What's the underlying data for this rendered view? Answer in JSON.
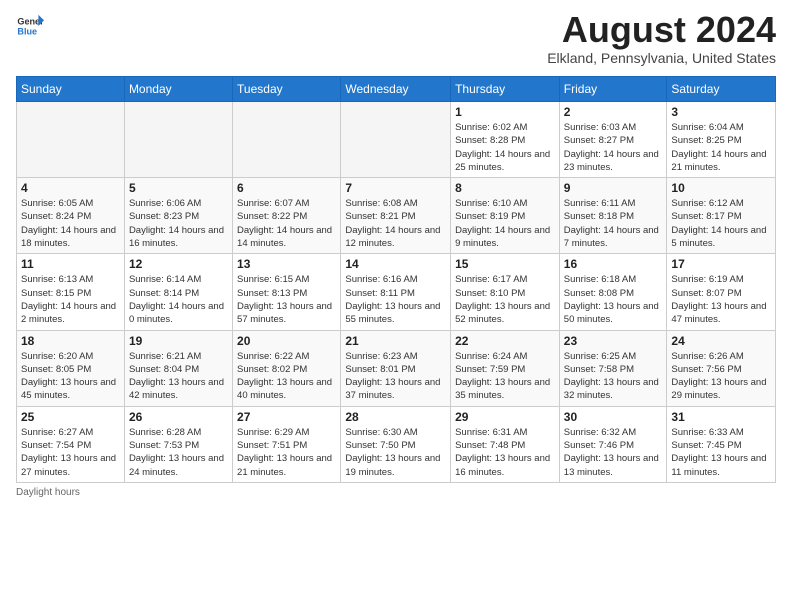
{
  "logo": {
    "line1": "General",
    "line2": "Blue"
  },
  "title": "August 2024",
  "subtitle": "Elkland, Pennsylvania, United States",
  "days_of_week": [
    "Sunday",
    "Monday",
    "Tuesday",
    "Wednesday",
    "Thursday",
    "Friday",
    "Saturday"
  ],
  "footer": "Daylight hours",
  "weeks": [
    [
      {
        "day": "",
        "info": ""
      },
      {
        "day": "",
        "info": ""
      },
      {
        "day": "",
        "info": ""
      },
      {
        "day": "",
        "info": ""
      },
      {
        "day": "1",
        "info": "Sunrise: 6:02 AM\nSunset: 8:28 PM\nDaylight: 14 hours and 25 minutes."
      },
      {
        "day": "2",
        "info": "Sunrise: 6:03 AM\nSunset: 8:27 PM\nDaylight: 14 hours and 23 minutes."
      },
      {
        "day": "3",
        "info": "Sunrise: 6:04 AM\nSunset: 8:25 PM\nDaylight: 14 hours and 21 minutes."
      }
    ],
    [
      {
        "day": "4",
        "info": "Sunrise: 6:05 AM\nSunset: 8:24 PM\nDaylight: 14 hours and 18 minutes."
      },
      {
        "day": "5",
        "info": "Sunrise: 6:06 AM\nSunset: 8:23 PM\nDaylight: 14 hours and 16 minutes."
      },
      {
        "day": "6",
        "info": "Sunrise: 6:07 AM\nSunset: 8:22 PM\nDaylight: 14 hours and 14 minutes."
      },
      {
        "day": "7",
        "info": "Sunrise: 6:08 AM\nSunset: 8:21 PM\nDaylight: 14 hours and 12 minutes."
      },
      {
        "day": "8",
        "info": "Sunrise: 6:10 AM\nSunset: 8:19 PM\nDaylight: 14 hours and 9 minutes."
      },
      {
        "day": "9",
        "info": "Sunrise: 6:11 AM\nSunset: 8:18 PM\nDaylight: 14 hours and 7 minutes."
      },
      {
        "day": "10",
        "info": "Sunrise: 6:12 AM\nSunset: 8:17 PM\nDaylight: 14 hours and 5 minutes."
      }
    ],
    [
      {
        "day": "11",
        "info": "Sunrise: 6:13 AM\nSunset: 8:15 PM\nDaylight: 14 hours and 2 minutes."
      },
      {
        "day": "12",
        "info": "Sunrise: 6:14 AM\nSunset: 8:14 PM\nDaylight: 14 hours and 0 minutes."
      },
      {
        "day": "13",
        "info": "Sunrise: 6:15 AM\nSunset: 8:13 PM\nDaylight: 13 hours and 57 minutes."
      },
      {
        "day": "14",
        "info": "Sunrise: 6:16 AM\nSunset: 8:11 PM\nDaylight: 13 hours and 55 minutes."
      },
      {
        "day": "15",
        "info": "Sunrise: 6:17 AM\nSunset: 8:10 PM\nDaylight: 13 hours and 52 minutes."
      },
      {
        "day": "16",
        "info": "Sunrise: 6:18 AM\nSunset: 8:08 PM\nDaylight: 13 hours and 50 minutes."
      },
      {
        "day": "17",
        "info": "Sunrise: 6:19 AM\nSunset: 8:07 PM\nDaylight: 13 hours and 47 minutes."
      }
    ],
    [
      {
        "day": "18",
        "info": "Sunrise: 6:20 AM\nSunset: 8:05 PM\nDaylight: 13 hours and 45 minutes."
      },
      {
        "day": "19",
        "info": "Sunrise: 6:21 AM\nSunset: 8:04 PM\nDaylight: 13 hours and 42 minutes."
      },
      {
        "day": "20",
        "info": "Sunrise: 6:22 AM\nSunset: 8:02 PM\nDaylight: 13 hours and 40 minutes."
      },
      {
        "day": "21",
        "info": "Sunrise: 6:23 AM\nSunset: 8:01 PM\nDaylight: 13 hours and 37 minutes."
      },
      {
        "day": "22",
        "info": "Sunrise: 6:24 AM\nSunset: 7:59 PM\nDaylight: 13 hours and 35 minutes."
      },
      {
        "day": "23",
        "info": "Sunrise: 6:25 AM\nSunset: 7:58 PM\nDaylight: 13 hours and 32 minutes."
      },
      {
        "day": "24",
        "info": "Sunrise: 6:26 AM\nSunset: 7:56 PM\nDaylight: 13 hours and 29 minutes."
      }
    ],
    [
      {
        "day": "25",
        "info": "Sunrise: 6:27 AM\nSunset: 7:54 PM\nDaylight: 13 hours and 27 minutes."
      },
      {
        "day": "26",
        "info": "Sunrise: 6:28 AM\nSunset: 7:53 PM\nDaylight: 13 hours and 24 minutes."
      },
      {
        "day": "27",
        "info": "Sunrise: 6:29 AM\nSunset: 7:51 PM\nDaylight: 13 hours and 21 minutes."
      },
      {
        "day": "28",
        "info": "Sunrise: 6:30 AM\nSunset: 7:50 PM\nDaylight: 13 hours and 19 minutes."
      },
      {
        "day": "29",
        "info": "Sunrise: 6:31 AM\nSunset: 7:48 PM\nDaylight: 13 hours and 16 minutes."
      },
      {
        "day": "30",
        "info": "Sunrise: 6:32 AM\nSunset: 7:46 PM\nDaylight: 13 hours and 13 minutes."
      },
      {
        "day": "31",
        "info": "Sunrise: 6:33 AM\nSunset: 7:45 PM\nDaylight: 13 hours and 11 minutes."
      }
    ]
  ]
}
